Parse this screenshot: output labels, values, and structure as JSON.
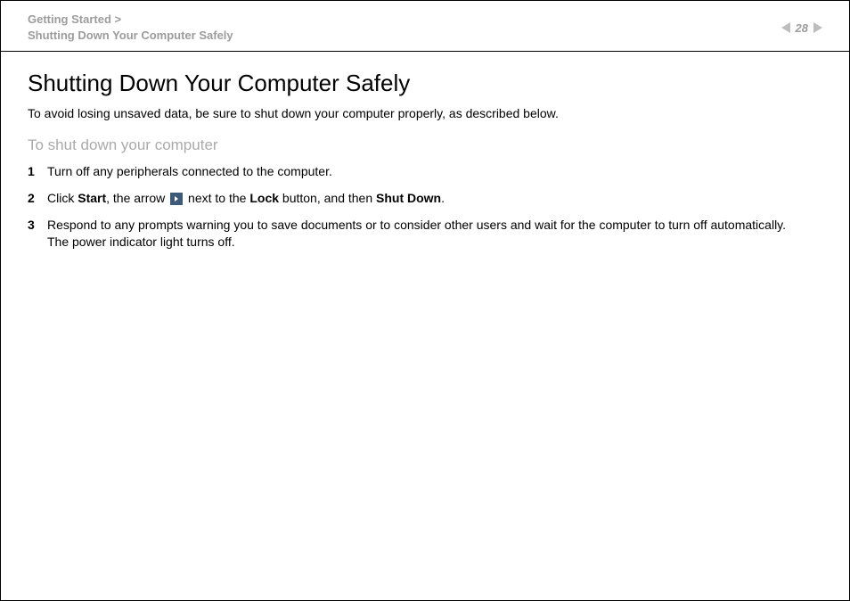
{
  "header": {
    "breadcrumb_line1": "Getting Started >",
    "breadcrumb_line2": "Shutting Down Your Computer Safely",
    "page_number": "28"
  },
  "main": {
    "title": "Shutting Down Your Computer Safely",
    "intro": "To avoid losing unsaved data, be sure to shut down your computer properly, as described below.",
    "subhead": "To shut down your computer",
    "steps": {
      "s1": "Turn off any peripherals connected to the computer.",
      "s2_a": "Click ",
      "s2_b": "Start",
      "s2_c": ", the arrow ",
      "s2_d": " next to the ",
      "s2_e": "Lock",
      "s2_f": " button, and then ",
      "s2_g": "Shut Down",
      "s2_h": ".",
      "s3_a": "Respond to any prompts warning you to save documents or to consider other users and wait for the computer to turn off automatically.",
      "s3_b": "The power indicator light turns off."
    }
  }
}
